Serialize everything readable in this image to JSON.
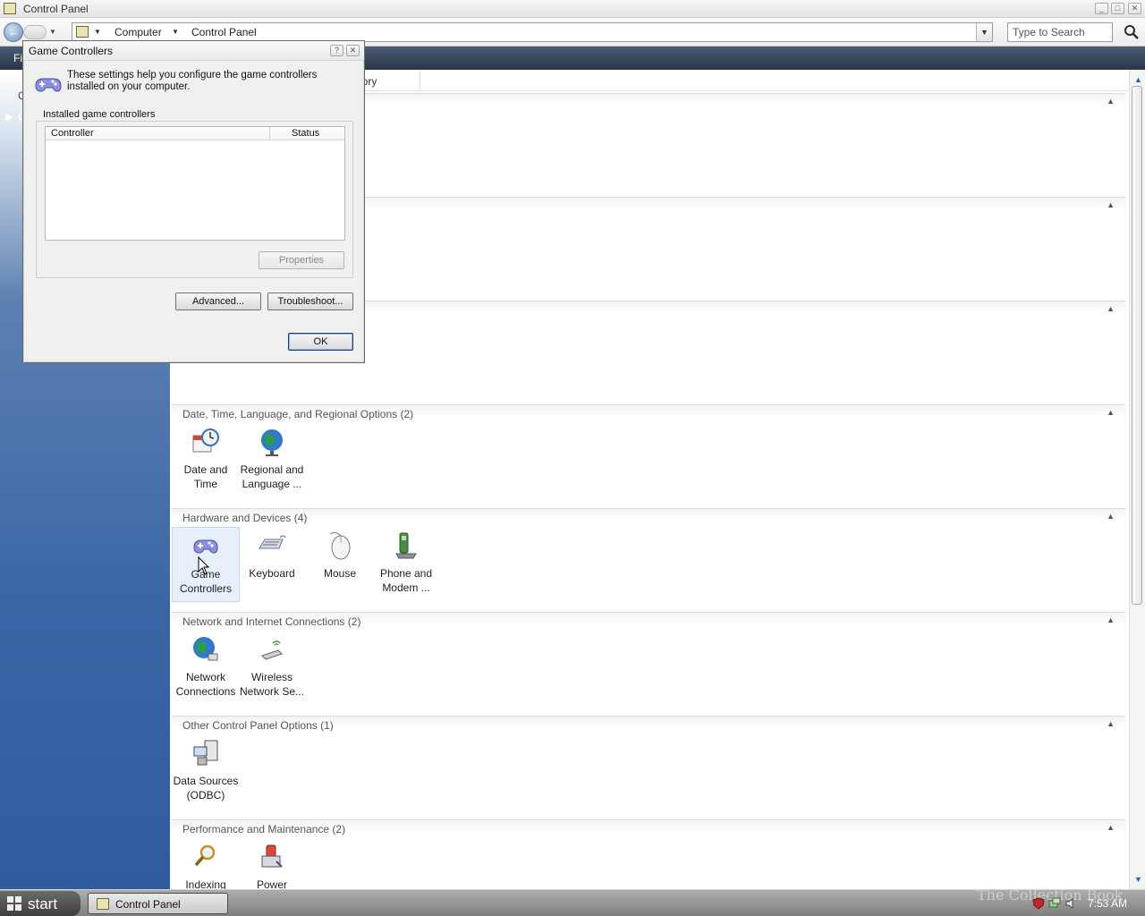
{
  "window": {
    "title": "Control Panel"
  },
  "address": {
    "crumbs": [
      "Computer",
      "Control Panel"
    ],
    "search_placeholder": "Type to Search"
  },
  "menu": {
    "file_fragment": "Fi"
  },
  "left_panel": {
    "text1": "C",
    "text2": "C"
  },
  "column_header": {
    "fragment": "nory"
  },
  "groups": [
    {
      "title": "Date, Time, Language, and Regional Options (2)",
      "items": [
        {
          "label": "Date and Time",
          "icon": "clock-calendar-icon"
        },
        {
          "label": "Regional and Language ...",
          "icon": "globe-icon"
        }
      ]
    },
    {
      "title": "Hardware and Devices (4)",
      "items": [
        {
          "label": "Game Controllers",
          "icon": "gamepad-icon"
        },
        {
          "label": "Keyboard",
          "icon": "keyboard-icon"
        },
        {
          "label": "Mouse",
          "icon": "mouse-icon"
        },
        {
          "label": "Phone and Modem ...",
          "icon": "phone-icon"
        }
      ]
    },
    {
      "title": "Network and Internet Connections (2)",
      "items": [
        {
          "label": "Network Connections",
          "icon": "network-globe-icon"
        },
        {
          "label": "Wireless Network Se...",
          "icon": "wireless-icon"
        }
      ]
    },
    {
      "title": "Other Control Panel Options (1)",
      "items": [
        {
          "label": "Data Sources (ODBC)",
          "icon": "database-icon"
        }
      ]
    },
    {
      "title": "Performance and Maintenance (2)",
      "items": [
        {
          "label": "Indexing",
          "icon": "magnifier-icon"
        },
        {
          "label": "Power",
          "icon": "power-icon"
        }
      ]
    }
  ],
  "dialog": {
    "title": "Game Controllers",
    "description": "These settings help you configure the game controllers installed on your computer.",
    "group_label": "Installed game controllers",
    "columns": [
      "Controller",
      "Status"
    ],
    "controllers": [],
    "properties_label": "Properties",
    "advanced_label": "Advanced...",
    "troubleshoot_label": "Troubleshoot...",
    "ok_label": "OK"
  },
  "taskbar": {
    "start_label": "start",
    "task_label": "Control Panel",
    "clock": "7:53 AM",
    "watermark": "The Collection Book"
  },
  "colors": {
    "accent": "#3a66a6",
    "menu_bar": "#2a3548",
    "selection": "#e7f0fa"
  }
}
